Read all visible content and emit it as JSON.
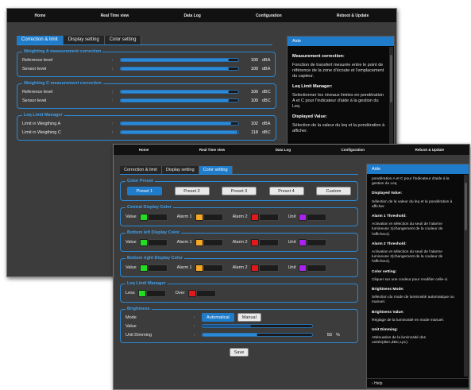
{
  "back": {
    "menu": [
      "Home",
      "Real Time view",
      "Data Log",
      "Configuration",
      "Reboot & Update"
    ],
    "tabs": [
      "Correction & limit",
      "Display setting",
      "Color setting"
    ],
    "weighting_a": {
      "legend": "Weighting A measurement correction",
      "rows": [
        {
          "label": "Reference level",
          "value": "100",
          "unit": "dBA",
          "fill": 0.92
        },
        {
          "label": "Sensor level",
          "value": "100",
          "unit": "dBA",
          "fill": 0.92
        }
      ]
    },
    "weighting_c": {
      "legend": "Weighting C measurement correction",
      "rows": [
        {
          "label": "Reference level",
          "value": "100",
          "unit": "dBC",
          "fill": 0.92
        },
        {
          "label": "Sensor level",
          "value": "100",
          "unit": "dBC",
          "fill": 0.92
        }
      ]
    },
    "leq": {
      "legend": "Leq Limit Manager",
      "rows": [
        {
          "label": "Limit in Weigthing A",
          "value": "102",
          "unit": "dBA",
          "fill": 0.94
        },
        {
          "label": "Limit in Weigthing C",
          "value": "118",
          "unit": "dBC",
          "fill": 0.99
        }
      ]
    },
    "aide": {
      "title": "Aide",
      "sections": [
        {
          "h": "Measurement correction:",
          "p": "Fonction de transfert mesurée entre le point de référence de la zone d'écoute et l'emplacement du capteur."
        },
        {
          "h": "Leq Limit Manager:",
          "p": "Selectionner les niveaux limites en pondération A et C pour l'indicateur d'aide à la gestion du Leq"
        },
        {
          "h": "Displayed Value:",
          "p": "Sélection de la valeur du leq et la pondération à afficher."
        }
      ]
    }
  },
  "front": {
    "menu": [
      "Home",
      "Real Time view",
      "Data Log",
      "Configuration",
      "Reboot & Update"
    ],
    "tabs": [
      "Correction & limit",
      "Display setting",
      "Color setting"
    ],
    "color_preset": {
      "legend": "Color Preset",
      "presets": [
        "Preset 1",
        "Preset 2",
        "Preset 3",
        "Preset 4",
        "Custom"
      ]
    },
    "central": {
      "legend": "Central Display Color",
      "items": [
        {
          "label": "Value",
          "color": "#22dd22"
        },
        {
          "label": "Alarm 1",
          "color": "#f5a623"
        },
        {
          "label": "Alarm 2",
          "color": "#e31818"
        },
        {
          "label": "Unit",
          "color": "#aa22ee"
        }
      ]
    },
    "bottom_left": {
      "legend": "Bottom left Display Color",
      "items": [
        {
          "label": "Value",
          "color": "#22dd22"
        },
        {
          "label": "Alarm 1",
          "color": "#f5a623"
        },
        {
          "label": "Alarm 2",
          "color": "#e31818"
        },
        {
          "label": "Unit",
          "color": "#aa22ee"
        }
      ]
    },
    "bottom_right": {
      "legend": "Bottom right Display Color",
      "items": [
        {
          "label": "Value",
          "color": "#22dd22"
        },
        {
          "label": "Alarm 1",
          "color": "#f5a623"
        },
        {
          "label": "Alarm 2",
          "color": "#e31818"
        },
        {
          "label": "Unit",
          "color": "#aa22ee"
        }
      ]
    },
    "leq": {
      "legend": "Leq Limit Manager",
      "items": [
        {
          "label": "Less",
          "color": "#22dd22"
        },
        {
          "label": "Over",
          "color": "#e31818"
        }
      ]
    },
    "brightness": {
      "legend": "Brightness",
      "mode_label": "Mode",
      "mode_options": [
        "Automatical",
        "Manual"
      ],
      "value_label": "Value",
      "dimming_label": "Unit Dimming",
      "dimming_value": "50",
      "dimming_unit": "%",
      "dimming_fill": 0.5,
      "value_fill": 0.44
    },
    "save_label": "Save",
    "aide": {
      "title": "Aide",
      "intro": "pondération A et C pour l'indicateur d'aide à la gestion du Leq",
      "sections": [
        {
          "h": "Displayed Value:",
          "p": "Sélection de la valeur du leq et la pondération à afficher."
        },
        {
          "h": "Alarm 1 Threshold:",
          "p": "Activation et sélection du seuil de l'alarme lumineuse 1(changement de la couleur de l'afficheur)."
        },
        {
          "h": "Alarm 2 Threshold:",
          "p": "Activation et sélection du seuil de l'alarme lumineuse 2(changement de la couleur de l'afficheur)."
        },
        {
          "h": "Color setting:",
          "p": "Cliquer sur une couleur pour modifier celle-ci."
        },
        {
          "h": "Brightness Mode:",
          "p": "Sélection du mode de luminosité automatique ou manuel."
        },
        {
          "h": "Brightness Value:",
          "p": "Réglage de la luminosité en mode manuel."
        },
        {
          "h": "Unit Dimming:",
          "p": "Atténuation de la luminosité des unités(dBA,dBC,Lpc)."
        }
      ],
      "help": "Help"
    }
  }
}
